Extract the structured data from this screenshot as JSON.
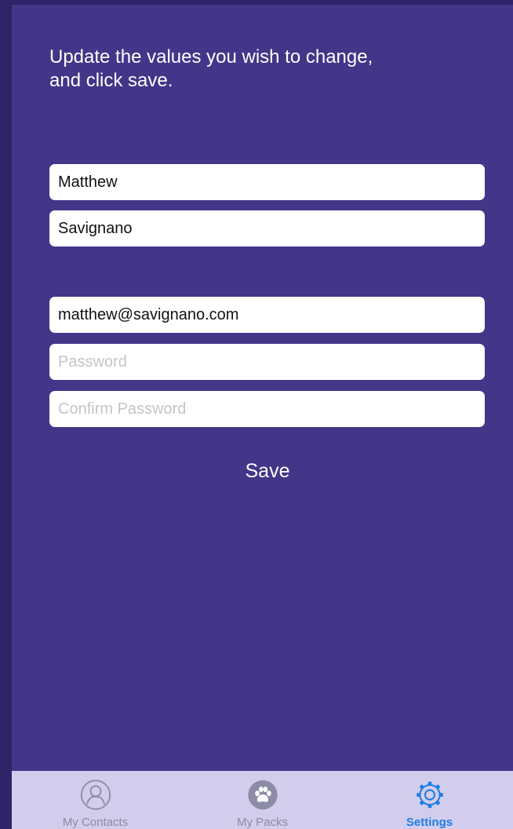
{
  "instructions": "Update the values you wish to change,\nand click save.",
  "form": {
    "first_name": {
      "value": "Matthew",
      "placeholder": ""
    },
    "last_name": {
      "value": "Savignano",
      "placeholder": ""
    },
    "email": {
      "value": "matthew@savignano.com",
      "placeholder": ""
    },
    "password": {
      "value": "",
      "placeholder": "Password"
    },
    "confirm_password": {
      "value": "",
      "placeholder": "Confirm Password"
    },
    "save_label": "Save"
  },
  "tabbar": {
    "tabs": [
      {
        "label": "My Contacts",
        "icon": "person-circle-icon",
        "active": false
      },
      {
        "label": "My Packs",
        "icon": "paw-icon",
        "active": false
      },
      {
        "label": "Settings",
        "icon": "gear-icon",
        "active": true
      }
    ]
  },
  "colors": {
    "background": "#433588",
    "tabbar_background": "#d2cdec",
    "tab_active": "#1e7ee4",
    "tab_inactive": "#8c8ca6",
    "text": "#ffffff"
  }
}
